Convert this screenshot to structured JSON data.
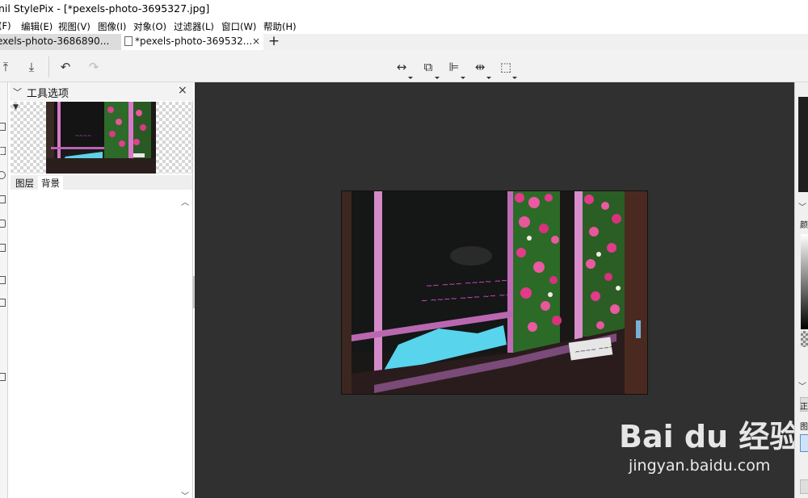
{
  "window": {
    "title": "nil StylePix - [*pexels-photo-3695327.jpg]"
  },
  "menu": [
    {
      "label": "(F)"
    },
    {
      "label": "编辑(E)"
    },
    {
      "label": "视图(V)"
    },
    {
      "label": "图像(I)"
    },
    {
      "label": "对象(O)"
    },
    {
      "label": "过滤器(L)"
    },
    {
      "label": "窗口(W)"
    },
    {
      "label": "帮助(H)"
    }
  ],
  "tabs": [
    {
      "label": "exels-photo-3686890...",
      "active": false
    },
    {
      "label": "*pexels-photo-369532...",
      "active": true
    }
  ],
  "tab_close": "×",
  "add_tab": "+",
  "toolbar": {
    "icons": [
      "upload-icon",
      "download-icon",
      "undo-icon",
      "redo-icon",
      "flip-horizontal-icon",
      "layer-copy-icon",
      "align-left-icon",
      "distribute-icon",
      "fit-screen-icon"
    ],
    "glyphs": {
      "upload": "⤒",
      "download": "⤓",
      "undo": "↶",
      "redo": "↷",
      "flip": "↔",
      "copy": "⧉",
      "align": "⊫",
      "distribute": "⇹",
      "fit": "⬚"
    }
  },
  "tool_options": {
    "title": "工具选项",
    "collapse_glyph": "﹀",
    "close_glyph": "×",
    "layer_tabs": [
      {
        "label": "图层",
        "selected": false
      },
      {
        "label": "背景",
        "selected": true
      }
    ],
    "scroll_up": "︿",
    "scroll_down": "﹀"
  },
  "canvas": {
    "background": "#303030"
  },
  "right_panel": {
    "label_color": "颜",
    "label_normal": "正",
    "label_layer": "图",
    "chevron": "﹀"
  },
  "watermark": {
    "logo": "Bai du 经验",
    "url": "jingyan.baidu.com"
  },
  "colors": {
    "neon_pink": "#e24fd6",
    "neon_cyan": "#52d6ee",
    "foliage": "#2e7a2e",
    "rose": "#e33a8c"
  }
}
